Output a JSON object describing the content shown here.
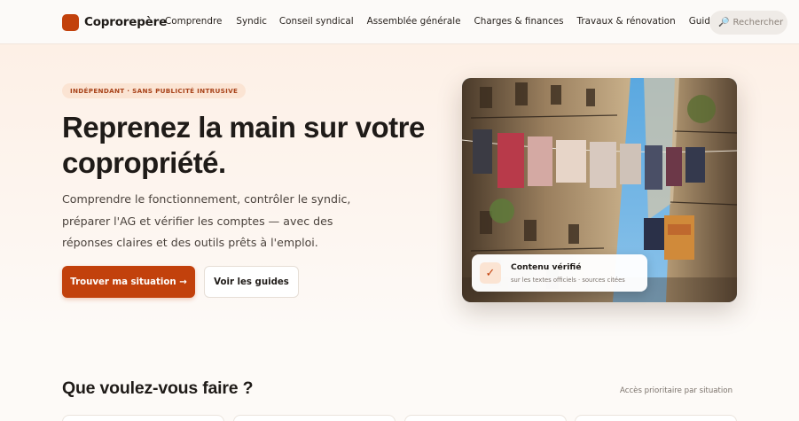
{
  "header": {
    "logo_text": "Coprorepère",
    "nav": [
      "Comprendre",
      "Syndic",
      "Conseil syndical",
      "Assemblée générale",
      "Charges & finances",
      "Travaux & rénovation",
      "Guides & outils"
    ],
    "search_placeholder": "Rechercher",
    "search_icon": "search-icon"
  },
  "hero": {
    "badge": "INDÉPENDANT · SANS PUBLICITÉ INTRUSIVE",
    "title": "Reprenez la main sur votre copropriété.",
    "lead": "Comprendre le fonctionnement, contrôler le syndic, préparer l'AG et vérifier les comptes — avec des réponses claires et des outils prêts à l'emploi.",
    "primary_button": "Trouver ma situation →",
    "secondary_button": "Voir les guides",
    "verified_title": "Contenu vérifié",
    "verified_sub": "sur les textes officiels · sources citées",
    "verified_icon": "check-icon"
  },
  "section": {
    "title": "Que voulez-vous faire ?",
    "note": "Accès prioritaire par situation"
  },
  "colors": {
    "accent": "#c2410c",
    "badge_bg": "#fbe4d3"
  }
}
